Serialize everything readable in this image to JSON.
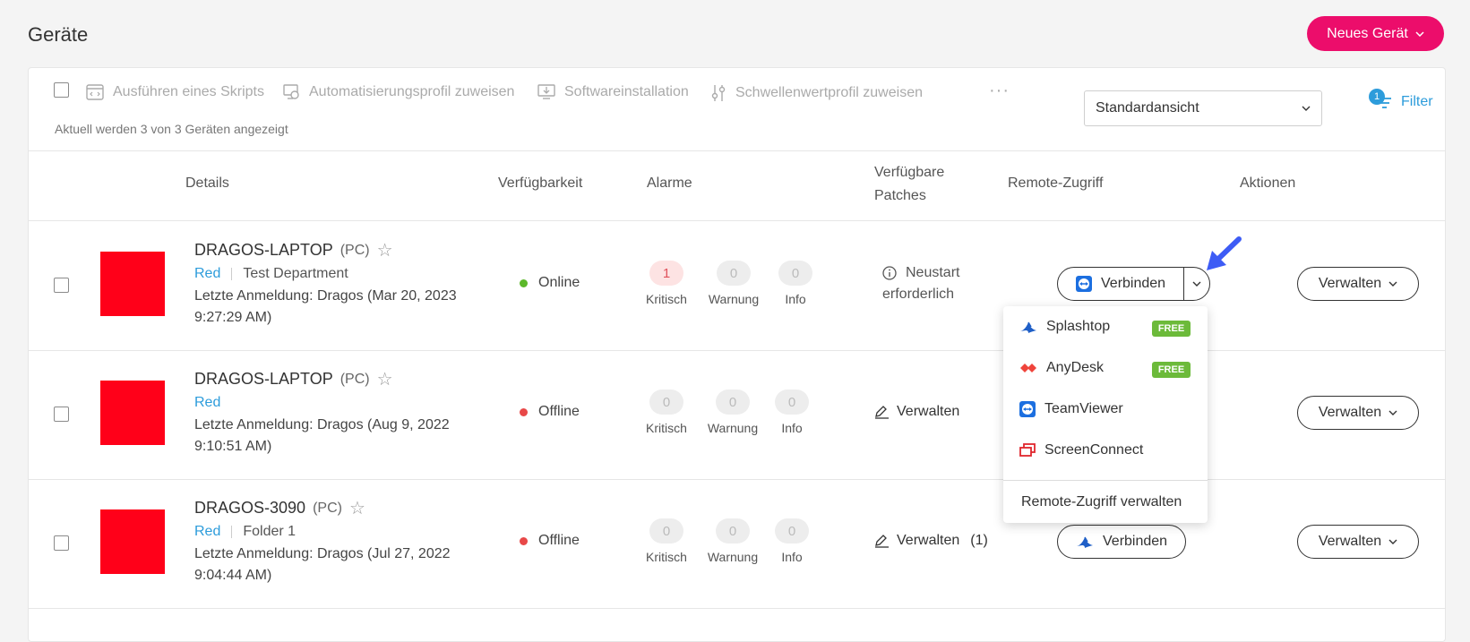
{
  "header": {
    "title": "Geräte",
    "new_device_label": "Neues Gerät"
  },
  "toolbar": {
    "actions": [
      {
        "label": "Ausführen eines Skripts",
        "icon": "script-icon"
      },
      {
        "label": "Automatisierungsprofil zuweisen",
        "icon": "automation-icon"
      },
      {
        "label": "Softwareinstallation",
        "icon": "software-install-icon"
      },
      {
        "label": "Schwellenwertprofil zuweisen",
        "icon": "threshold-icon"
      }
    ],
    "more_label": "···",
    "count_text": "Aktuell werden 3 von 3 Geräten angezeigt",
    "view_select_value": "Standardansicht",
    "filter_label": "Filter",
    "filter_badge": "1"
  },
  "columns": {
    "details": "Details",
    "availability": "Verfügbarkeit",
    "alarms": "Alarme",
    "patches_line1": "Verfügbare",
    "patches_line2": "Patches",
    "remote": "Remote-Zugriff",
    "actions": "Aktionen"
  },
  "devices": [
    {
      "name": "DRAGOS-LAPTOP",
      "type": "(PC)",
      "tag": "Red",
      "department": "Test Department",
      "login_line1": "Letzte Anmeldung: Dragos (Mar 20, 2023",
      "login_line2": "9:27:29 AM)",
      "status": "Online",
      "status_color": "#5cb82a",
      "alarms": {
        "critical": "1",
        "warning": "0",
        "info": "0"
      },
      "patch_line1": "Neustart",
      "patch_line2": "erforderlich",
      "connect_label": "Verbinden",
      "manage_label": "Verwalten"
    },
    {
      "name": "DRAGOS-LAPTOP",
      "type": "(PC)",
      "tag": "Red",
      "department": "",
      "login_line1": "Letzte Anmeldung: Dragos (Aug 9, 2022",
      "login_line2": "9:10:51 AM)",
      "status": "Offline",
      "status_color": "#e84848",
      "alarms": {
        "critical": "0",
        "warning": "0",
        "info": "0"
      },
      "patch_label": "Verwalten",
      "manage_label": "Verwalten"
    },
    {
      "name": "DRAGOS-3090",
      "type": "(PC)",
      "tag": "Red",
      "department": "Folder 1",
      "login_line1": "Letzte Anmeldung: Dragos (Jul 27, 2022",
      "login_line2": "9:04:44 AM)",
      "status": "Offline",
      "status_color": "#e84848",
      "alarms": {
        "critical": "0",
        "warning": "0",
        "info": "0"
      },
      "patch_label": "Verwalten",
      "patch_count": "(1)",
      "connect_label": "Verbinden",
      "manage_label": "Verwalten"
    }
  ],
  "alarm_labels": {
    "critical": "Kritisch",
    "warning": "Warnung",
    "info": "Info"
  },
  "remote_dropdown": {
    "items": [
      {
        "label": "Splashtop",
        "badge": "FREE",
        "icon": "splashtop-icon"
      },
      {
        "label": "AnyDesk",
        "badge": "FREE",
        "icon": "anydesk-icon"
      },
      {
        "label": "TeamViewer",
        "icon": "teamviewer-icon"
      },
      {
        "label": "ScreenConnect",
        "icon": "screenconnect-icon"
      }
    ],
    "footer": "Remote-Zugriff verwalten"
  },
  "colors": {
    "accent": "#ec0d6b",
    "link": "#2d9cdb",
    "device_thumb": "#ff0019",
    "free_badge": "#6cba3a",
    "annotation_arrow": "#3d5cf5"
  }
}
